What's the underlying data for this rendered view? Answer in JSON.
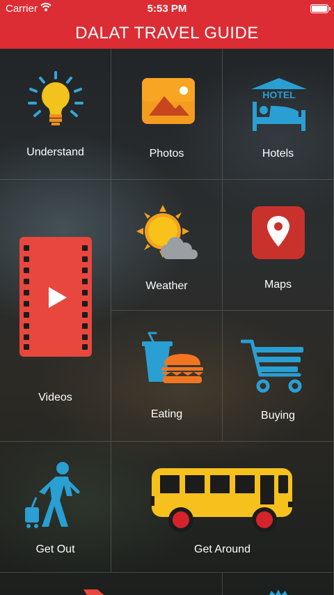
{
  "status_bar": {
    "carrier": "Carrier",
    "time": "5:53 PM"
  },
  "header": {
    "title": "DALAT TRAVEL GUIDE"
  },
  "menu": {
    "understand": "Understand",
    "photos": "Photos",
    "hotels": "Hotels",
    "hotel_sign": "HOTEL",
    "videos": "Videos",
    "weather": "Weather",
    "maps": "Maps",
    "eating": "Eating",
    "buying": "Buying",
    "get_out": "Get Out",
    "get_around": "Get Around"
  },
  "colors": {
    "brand_red": "#dc2c34"
  }
}
